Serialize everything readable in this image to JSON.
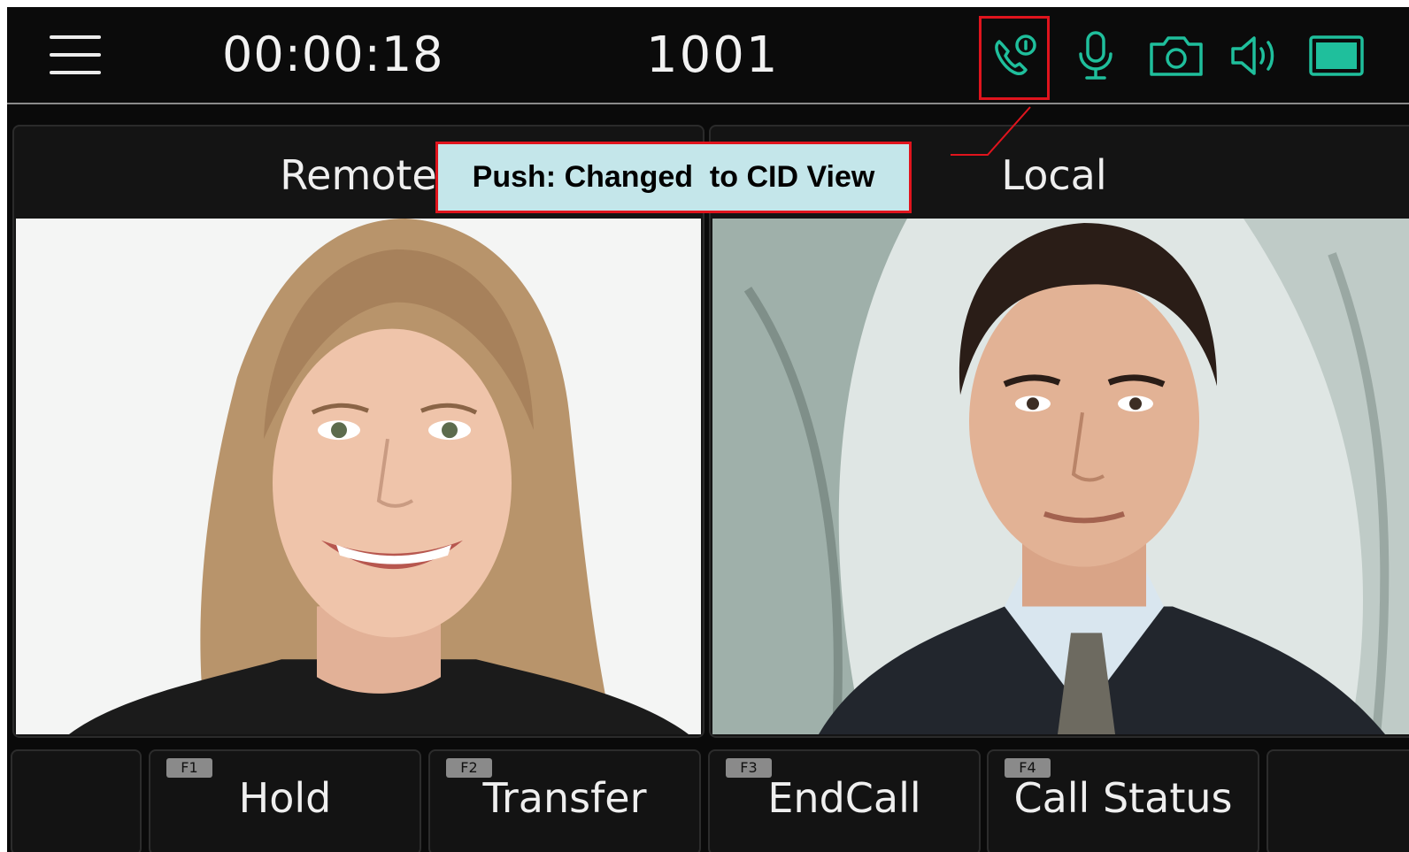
{
  "topbar": {
    "timer": "00:00:18",
    "number": "1001",
    "icons": [
      "call-info-icon",
      "microphone-icon",
      "camera-icon",
      "speaker-icon",
      "display-icon"
    ],
    "icon_color": "#1fbf9c"
  },
  "panels": {
    "remote_title": "Remote",
    "local_title": "Local"
  },
  "softkeys": [
    {
      "badge": "F1",
      "label": "Hold"
    },
    {
      "badge": "F2",
      "label": "Transfer"
    },
    {
      "badge": "F3",
      "label": "EndCall"
    },
    {
      "badge": "F4",
      "label": "Call Status"
    }
  ],
  "callout": {
    "text": "Push: Changed  to CID View",
    "border_color": "#e0141d",
    "background": "#c4e6ea"
  }
}
